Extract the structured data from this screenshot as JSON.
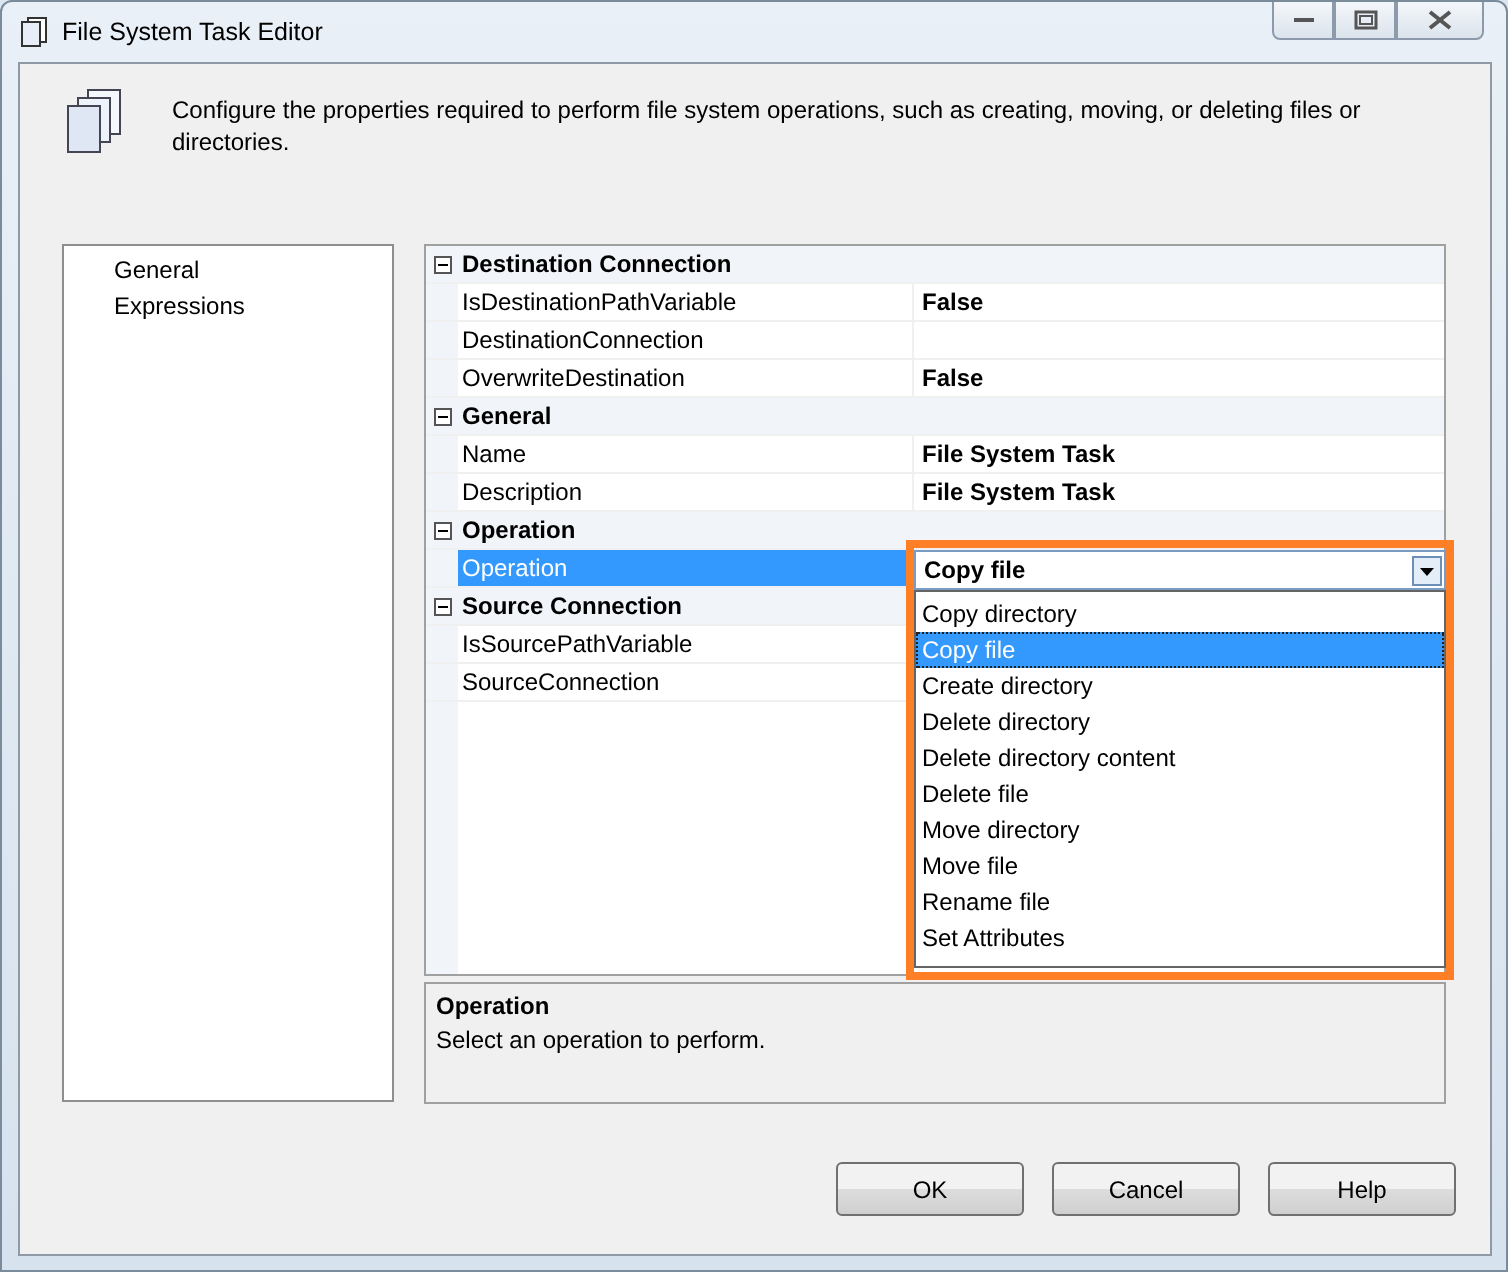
{
  "window": {
    "title": "File System Task Editor"
  },
  "header": {
    "description": "Configure the properties required to perform file system operations, such as creating, moving, or deleting files or directories."
  },
  "nav": {
    "items": [
      {
        "label": "General"
      },
      {
        "label": "Expressions"
      }
    ]
  },
  "property_grid": {
    "categories": [
      {
        "name": "Destination Connection",
        "expanded": true,
        "properties": [
          {
            "name": "IsDestinationPathVariable",
            "value": "False",
            "selected": false
          },
          {
            "name": "DestinationConnection",
            "selected": false
          },
          {
            "name": "OverwriteDestination",
            "value": "False",
            "selected": false
          }
        ]
      },
      {
        "name": "General",
        "expanded": true,
        "properties": [
          {
            "name": "Name",
            "value": "File System Task",
            "selected": false
          },
          {
            "name": "Description",
            "value": "File System Task",
            "selected": false
          }
        ]
      },
      {
        "name": "Operation",
        "expanded": true,
        "properties": [
          {
            "name": "Operation",
            "selected": true
          }
        ]
      },
      {
        "name": "Source Connection",
        "expanded": true,
        "properties": [
          {
            "name": "IsSourcePathVariable",
            "selected": false
          },
          {
            "name": "SourceConnection",
            "selected": false
          }
        ]
      }
    ]
  },
  "dropdown": {
    "value": "Copy file",
    "highlighted": true,
    "options": [
      {
        "label": "Copy directory",
        "selected": false
      },
      {
        "label": "Copy file",
        "selected": true
      },
      {
        "label": "Create directory",
        "selected": false
      },
      {
        "label": "Delete directory",
        "selected": false
      },
      {
        "label": "Delete directory content",
        "selected": false
      },
      {
        "label": "Delete file",
        "selected": false
      },
      {
        "label": "Move directory",
        "selected": false
      },
      {
        "label": "Move file",
        "selected": false
      },
      {
        "label": "Rename file",
        "selected": false
      },
      {
        "label": "Set Attributes",
        "selected": false
      }
    ]
  },
  "description_panel": {
    "title": "Operation",
    "text": "Select an operation to perform."
  },
  "buttons": [
    "OK",
    "Cancel",
    "Help"
  ]
}
